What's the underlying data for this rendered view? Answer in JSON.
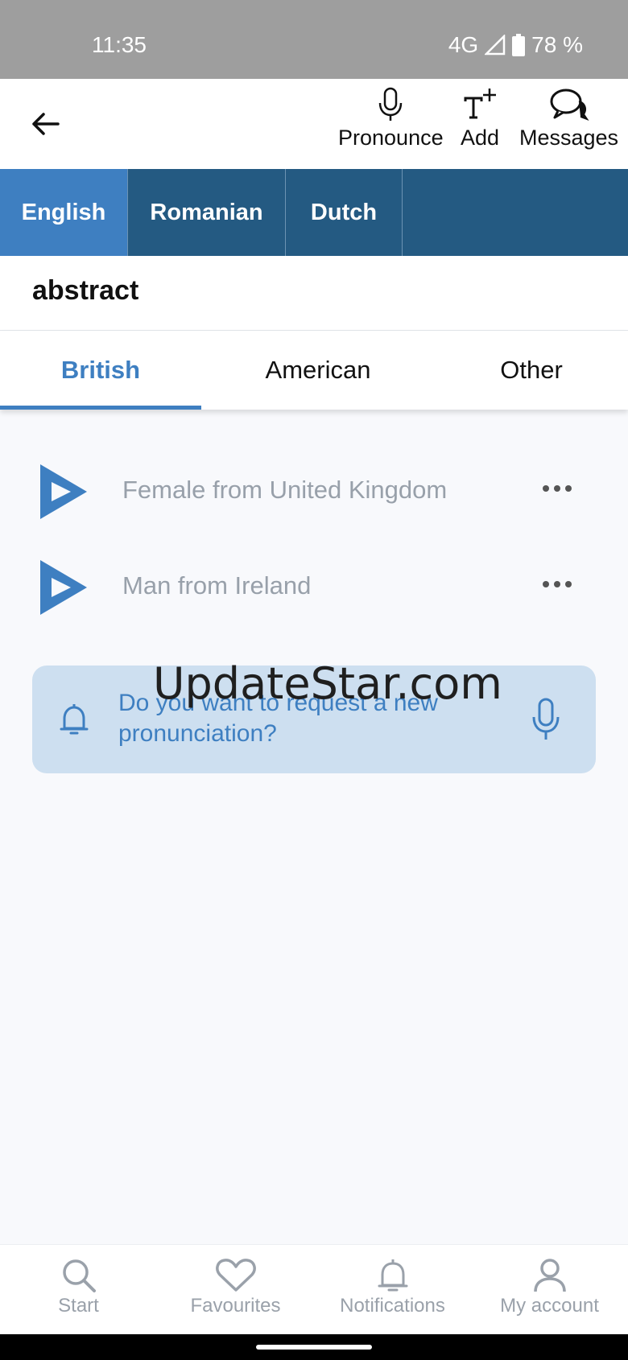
{
  "status_bar": {
    "time": "11:35",
    "network": "4G",
    "battery": "78 %"
  },
  "app_bar": {
    "actions": [
      {
        "label": "Pronounce",
        "icon": "microphone-icon"
      },
      {
        "label": "Add",
        "icon": "add-text-icon"
      },
      {
        "label": "Messages",
        "icon": "chat-bubbles-icon"
      }
    ]
  },
  "languages": [
    {
      "label": "English",
      "active": true
    },
    {
      "label": "Romanian",
      "active": false
    },
    {
      "label": "Dutch",
      "active": false
    }
  ],
  "word": "abstract",
  "accent_tabs": [
    {
      "label": "British",
      "active": true
    },
    {
      "label": "American",
      "active": false
    },
    {
      "label": "Other",
      "active": false
    }
  ],
  "pronunciations": [
    {
      "speaker": "Female from United Kingdom"
    },
    {
      "speaker": "Man from Ireland"
    }
  ],
  "request": {
    "text": "Do you want to request a new pronunciation?"
  },
  "watermark": "UpdateStar.com",
  "bottom_nav": [
    {
      "label": "Start",
      "icon": "search-icon"
    },
    {
      "label": "Favourites",
      "icon": "heart-icon"
    },
    {
      "label": "Notifications",
      "icon": "bell-icon"
    },
    {
      "label": "My account",
      "icon": "user-icon"
    }
  ],
  "colors": {
    "primary": "#3e7fc1",
    "dark_blue": "#245a82",
    "muted_text": "#98a0aa",
    "request_bg": "#cddff0"
  }
}
